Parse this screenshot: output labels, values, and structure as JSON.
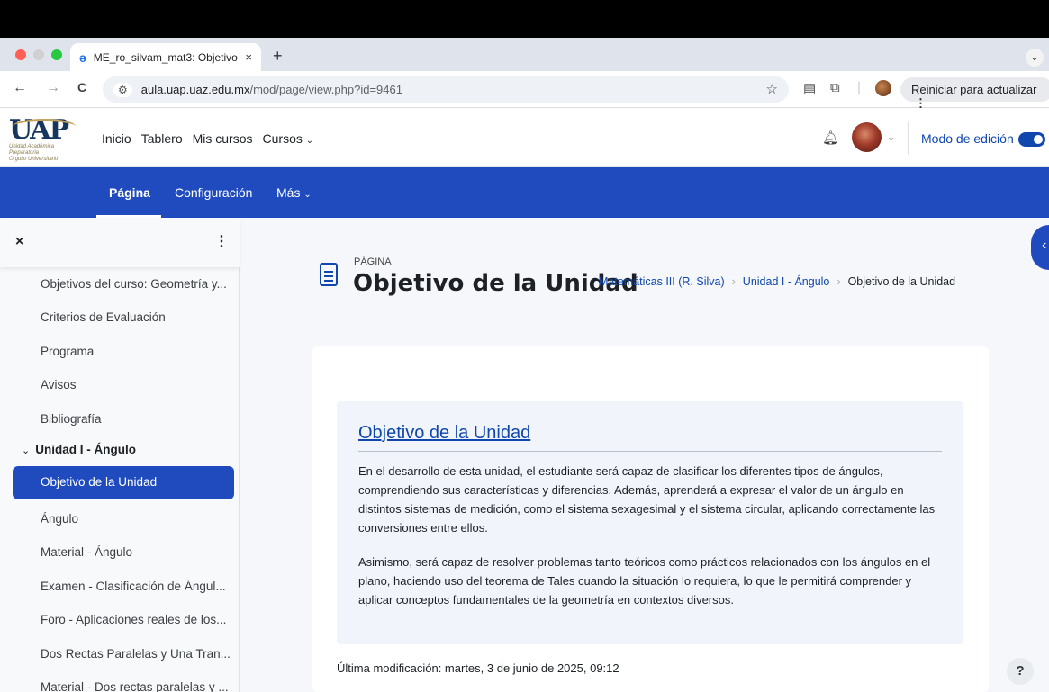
{
  "browser": {
    "tab_title": "ME_ro_silvam_mat3: Objetivo",
    "tab_close": "×",
    "new_tab": "+",
    "tab_menu": "⌄",
    "back": "←",
    "forward": "→",
    "reload": "C",
    "url_host": "aula.uap.uaz.edu.mx",
    "url_path": "/mod/page/view.php?id=9461",
    "relaunch_label": "Reiniciar para actualizar",
    "relaunch_more": "⋮"
  },
  "header": {
    "logo_text": "UAP",
    "logo_sub": "Unidad Académica Preparatoria",
    "logo_sub2": "Orgullo Universitario",
    "nav": [
      "Inicio",
      "Tablero",
      "Mis cursos",
      "Cursos"
    ],
    "edit_mode_label": "Modo de edición",
    "edit_mode_on": true
  },
  "secondary_nav": {
    "items": [
      "Página",
      "Configuración",
      "Más"
    ]
  },
  "drawer": {
    "close": "×",
    "more": "⋮",
    "items": [
      "Objetivos del curso: Geometría y...",
      "Criterios de Evaluación",
      "Programa",
      "Avisos",
      "Bibliografía"
    ],
    "section": "Unidad I - Ángulo",
    "active_item": "Objetivo de la Unidad",
    "section_items": [
      "Ángulo",
      "Material - Ángulo",
      "Examen - Clasificación de Ángul...",
      "Foro - Aplicaciones reales de los...",
      "Dos Rectas Paralelas y Una Tran...",
      "Material - Dos rectas paralelas y ..."
    ]
  },
  "page": {
    "kicker": "PÁGINA",
    "title": "Objetivo de la Unidad",
    "breadcrumb": [
      "Matemáticas III (R. Silva)",
      "Unidad I - Ángulo",
      "Objetivo de la Unidad"
    ],
    "content_title": "Objetivo de la Unidad",
    "paragraphs": [
      "En el desarrollo de esta unidad, el estudiante será capaz de clasificar los diferentes tipos de ángulos, comprendiendo sus características y diferencias. Además, aprenderá a expresar el valor de un ángulo en distintos sistemas de medición, como el sistema sexagesimal y el sistema circular, aplicando correctamente las conversiones entre ellos.",
      "Asimismo, será capaz de resolver problemas tanto teóricos como prácticos relacionados con los ángulos en el plano, haciendo uso del teorema de Tales cuando la situación lo requiera, lo que le permitirá comprender y aplicar conceptos fundamentales de la geometría en contextos diversos."
    ],
    "last_modified": "Última modificación: martes, 3 de junio de 2025, 09:12"
  },
  "help_label": "?",
  "colors": {
    "primary": "#1f4bbf",
    "link": "#0f47ad",
    "content_bg": "#f1f5fb"
  }
}
